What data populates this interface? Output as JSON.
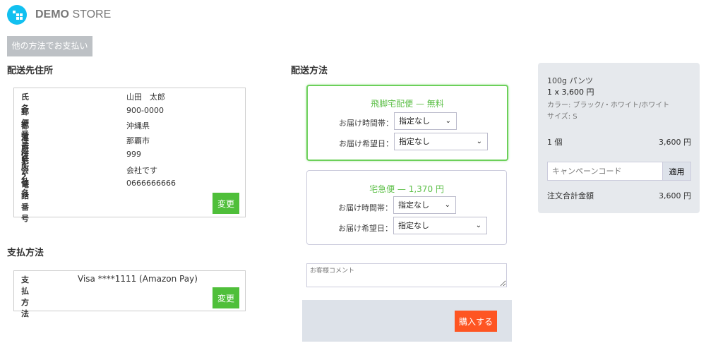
{
  "header": {
    "brand_bold": "DEMO",
    "brand_light": "STORE",
    "other_payment": "他の方法でお支払い"
  },
  "address": {
    "title": "配送先住所",
    "rows": [
      {
        "k": "氏名",
        "v": "山田　太郎"
      },
      {
        "k": "郵便番号",
        "v": "900-0000"
      },
      {
        "k": "都道府県",
        "v": "沖縄県"
      },
      {
        "k": "住所1",
        "v": "那覇市"
      },
      {
        "k": "住所2",
        "v": "999"
      },
      {
        "k": "会社名",
        "v": "会社です"
      },
      {
        "k": "電話番号",
        "v": "0666666666"
      }
    ],
    "change": "変更"
  },
  "payment": {
    "title": "支払方法",
    "k": "支払方法",
    "v": "Visa ****1111 (Amazon Pay)",
    "change": "変更"
  },
  "shipping": {
    "title": "配送方法",
    "options": [
      {
        "name": "飛脚宅配便 — 無料",
        "time_label": "お届け時間帯：",
        "time": "指定なし",
        "date_label": "お届け希望日：",
        "date": "指定なし"
      },
      {
        "name": "宅急便 — 1,370 円",
        "time_label": "お届け時間帯：",
        "time": "指定なし",
        "date_label": "お届け希望日：",
        "date": "指定なし"
      }
    ]
  },
  "comment_placeholder": "お客様コメント",
  "buy": "購入する",
  "summary": {
    "product": "100g パンツ",
    "qty_price": "1 x 3,600 円",
    "color": "カラー: ブラック/・ホワイト/ホワイト",
    "size": "サイズ: S",
    "count": "1 個",
    "subtotal": "3,600 円",
    "campaign_placeholder": "キャンペーンコード",
    "apply": "適用",
    "total_label": "注文合計金額",
    "total": "3,600 円"
  }
}
